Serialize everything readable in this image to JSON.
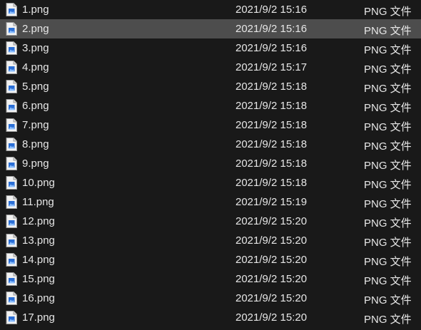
{
  "files": [
    {
      "name": "1.png",
      "modified": "2021/9/2 15:16",
      "type": "PNG 文件",
      "icon": "png-file-icon",
      "selected": false
    },
    {
      "name": "2.png",
      "modified": "2021/9/2 15:16",
      "type": "PNG 文件",
      "icon": "png-file-icon",
      "selected": true
    },
    {
      "name": "3.png",
      "modified": "2021/9/2 15:16",
      "type": "PNG 文件",
      "icon": "png-file-icon",
      "selected": false
    },
    {
      "name": "4.png",
      "modified": "2021/9/2 15:17",
      "type": "PNG 文件",
      "icon": "png-file-icon",
      "selected": false
    },
    {
      "name": "5.png",
      "modified": "2021/9/2 15:18",
      "type": "PNG 文件",
      "icon": "png-file-icon",
      "selected": false
    },
    {
      "name": "6.png",
      "modified": "2021/9/2 15:18",
      "type": "PNG 文件",
      "icon": "png-file-icon",
      "selected": false
    },
    {
      "name": "7.png",
      "modified": "2021/9/2 15:18",
      "type": "PNG 文件",
      "icon": "png-file-icon",
      "selected": false
    },
    {
      "name": "8.png",
      "modified": "2021/9/2 15:18",
      "type": "PNG 文件",
      "icon": "png-file-icon",
      "selected": false
    },
    {
      "name": "9.png",
      "modified": "2021/9/2 15:18",
      "type": "PNG 文件",
      "icon": "png-file-icon",
      "selected": false
    },
    {
      "name": "10.png",
      "modified": "2021/9/2 15:18",
      "type": "PNG 文件",
      "icon": "png-file-icon",
      "selected": false
    },
    {
      "name": "11.png",
      "modified": "2021/9/2 15:19",
      "type": "PNG 文件",
      "icon": "png-file-icon",
      "selected": false
    },
    {
      "name": "12.png",
      "modified": "2021/9/2 15:20",
      "type": "PNG 文件",
      "icon": "png-file-icon",
      "selected": false
    },
    {
      "name": "13.png",
      "modified": "2021/9/2 15:20",
      "type": "PNG 文件",
      "icon": "png-file-icon",
      "selected": false
    },
    {
      "name": "14.png",
      "modified": "2021/9/2 15:20",
      "type": "PNG 文件",
      "icon": "png-file-icon",
      "selected": false
    },
    {
      "name": "15.png",
      "modified": "2021/9/2 15:20",
      "type": "PNG 文件",
      "icon": "png-file-icon",
      "selected": false
    },
    {
      "name": "16.png",
      "modified": "2021/9/2 15:20",
      "type": "PNG 文件",
      "icon": "png-file-icon",
      "selected": false
    },
    {
      "name": "17.png",
      "modified": "2021/9/2 15:20",
      "type": "PNG 文件",
      "icon": "png-file-icon",
      "selected": false
    }
  ],
  "colors": {
    "background": "#191919",
    "selected_row": "#4d4d4d",
    "text": "#e6e6e6",
    "icon_accent": "#2b6fd6"
  }
}
